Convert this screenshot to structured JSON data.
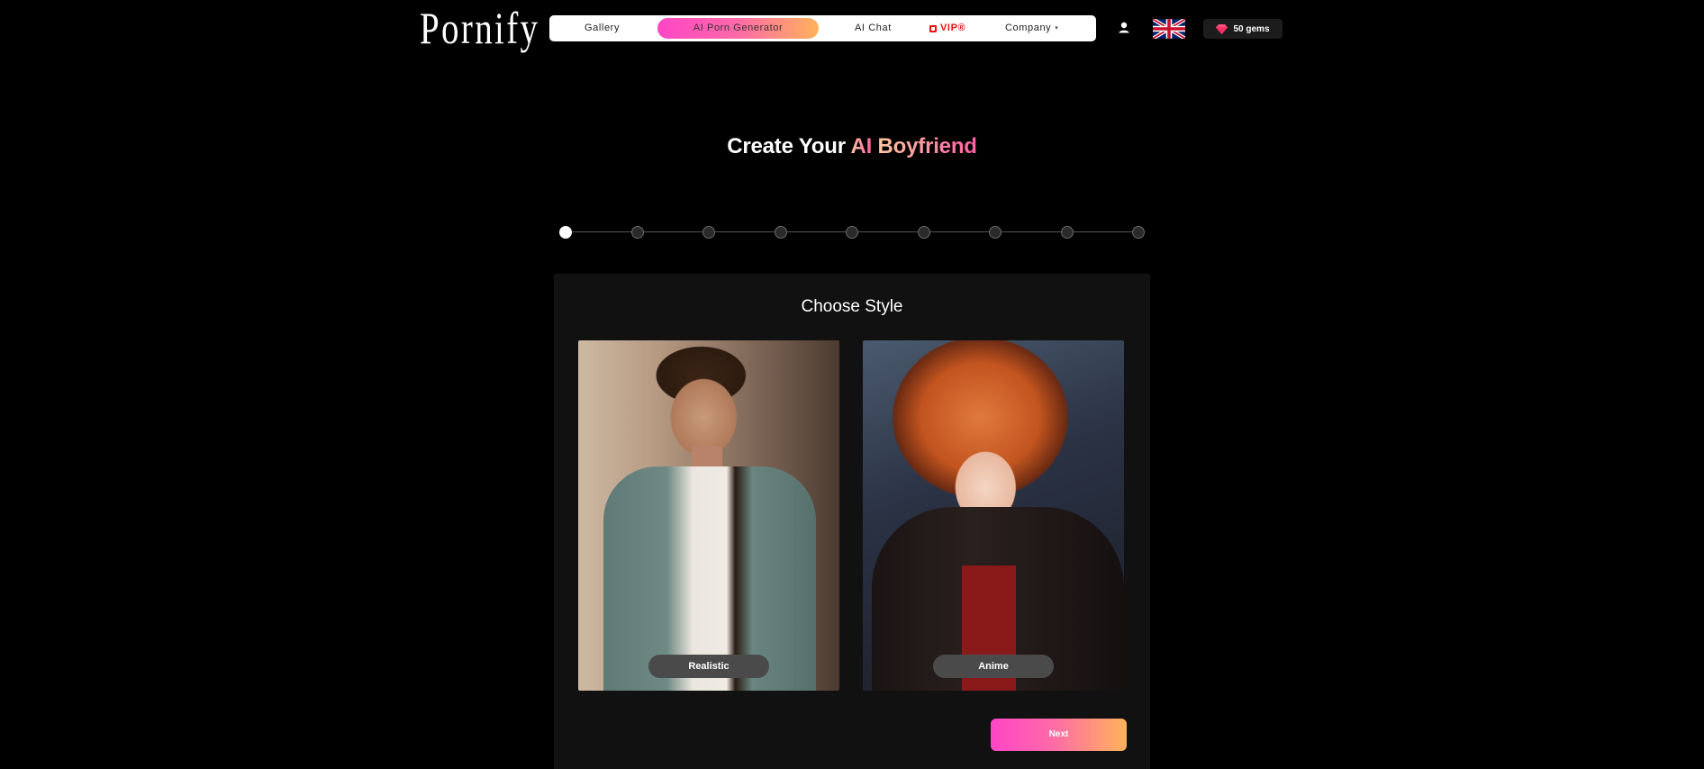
{
  "header": {
    "logo": "Pornify",
    "nav": {
      "gallery": "Gallery",
      "ai_generator": "AI Porn Generator",
      "ai_chat": "AI Chat",
      "vip": "VIP®",
      "company": "Company"
    },
    "gems": "50 gems"
  },
  "hero": {
    "title_prefix": "Create Your ",
    "title_ai": "AI",
    "title_highlight": "Boyfriend"
  },
  "stepper": {
    "total_steps": 9,
    "current_step": 1
  },
  "panel": {
    "title": "Choose Style",
    "options": [
      {
        "label": "Realistic"
      },
      {
        "label": "Anime"
      }
    ],
    "next_label": "Next"
  },
  "colors": {
    "accent_gradient_start": "#ff45c6",
    "accent_gradient_end": "#ffb35a",
    "vip": "#ee1111",
    "background": "#000000",
    "panel": "#111111"
  },
  "icons": {
    "user": "user-icon",
    "flag": "uk-flag-icon",
    "gem": "gem-icon",
    "vip": "vip-icon",
    "company_caret": "chevron-down-icon"
  }
}
